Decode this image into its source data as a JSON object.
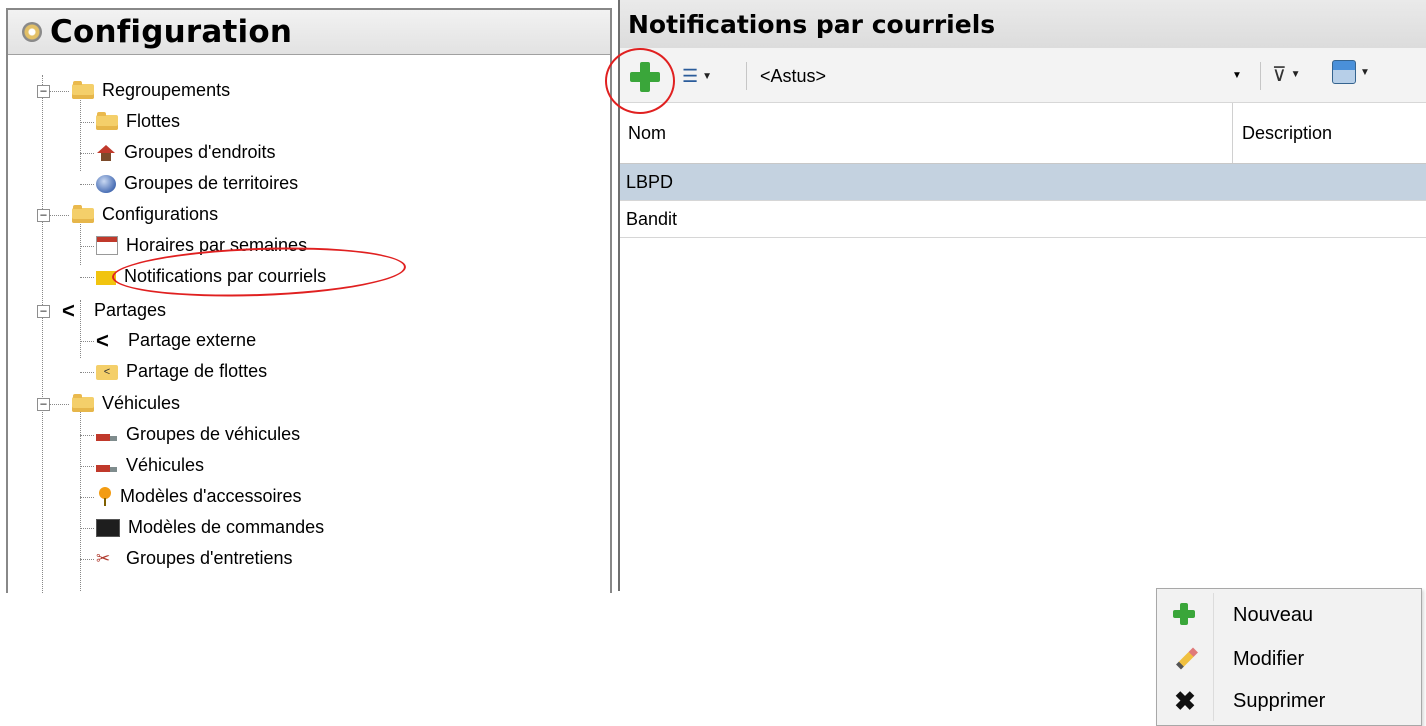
{
  "left": {
    "title": "Configuration",
    "tree": [
      {
        "label": "Regroupements",
        "icon": "folder-icon",
        "level": 0,
        "expanded": true
      },
      {
        "label": "Flottes",
        "icon": "folder-icon",
        "level": 1
      },
      {
        "label": "Groupes d'endroits",
        "icon": "house-icon",
        "level": 1
      },
      {
        "label": "Groupes de territoires",
        "icon": "globe-icon",
        "level": 1
      },
      {
        "label": "Configurations",
        "icon": "folder-icon",
        "level": 0,
        "expanded": true
      },
      {
        "label": "Horaires par semaines",
        "icon": "calendar-icon",
        "level": 1
      },
      {
        "label": "Notifications par courriels",
        "icon": "envelope-icon",
        "level": 1
      },
      {
        "label": "Partages",
        "icon": "share-icon",
        "level": 0,
        "expanded": true
      },
      {
        "label": "Partage externe",
        "icon": "share-icon",
        "level": 1
      },
      {
        "label": "Partage de flottes",
        "icon": "shared-folder-icon",
        "level": 1
      },
      {
        "label": "Véhicules",
        "icon": "folder-icon",
        "level": 0,
        "expanded": true
      },
      {
        "label": "Groupes de véhicules",
        "icon": "truck-icon",
        "level": 1
      },
      {
        "label": "Véhicules",
        "icon": "truck-icon",
        "level": 1
      },
      {
        "label": "Modèles d'accessoires",
        "icon": "pin-icon",
        "level": 1
      },
      {
        "label": "Modèles de commandes",
        "icon": "terminal-icon",
        "level": 1
      },
      {
        "label": "Groupes d'entretiens",
        "icon": "wrench-icon",
        "level": 1
      }
    ]
  },
  "right": {
    "title": "Notifications par courriels",
    "toolbar": {
      "company": "<Astus>"
    },
    "columns": [
      "Nom",
      "Description"
    ],
    "rows": [
      {
        "nom": "LBPD",
        "description": "",
        "selected": true
      },
      {
        "nom": "Bandit",
        "description": "",
        "selected": false
      }
    ]
  },
  "context_menu": {
    "items": [
      {
        "label": "Nouveau",
        "icon": "plus-icon"
      },
      {
        "label": "Modifier",
        "icon": "pencil-icon"
      },
      {
        "label": "Supprimer",
        "icon": "x-icon"
      }
    ]
  },
  "colors": {
    "selected_row": "#c4d2e0",
    "annotation_red": "#e02020",
    "add_green": "#3aa63a"
  }
}
